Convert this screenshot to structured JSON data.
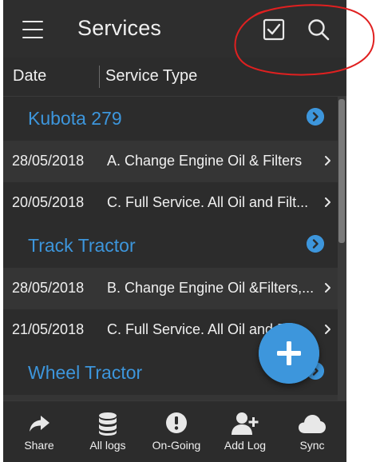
{
  "appbar": {
    "title": "Services",
    "menu_icon": "hamburger-menu-icon",
    "select_icon": "checkbox-icon",
    "search_icon": "search-icon"
  },
  "columns": {
    "date": "Date",
    "service_type": "Service Type"
  },
  "groups": [
    {
      "name": "Kubota 279",
      "rows": [
        {
          "date": "28/05/2018",
          "type": "A. Change Engine Oil & Filters"
        },
        {
          "date": "20/05/2018",
          "type": "C. Full Service. All Oil and Filt..."
        }
      ]
    },
    {
      "name": "Track Tractor",
      "rows": [
        {
          "date": "28/05/2018",
          "type": "B. Change Engine Oil &Filters,..."
        },
        {
          "date": "21/05/2018",
          "type": "C. Full Service. All Oil and Filt..."
        }
      ]
    },
    {
      "name": "Wheel Tractor",
      "rows": []
    }
  ],
  "fab": {
    "icon": "plus-icon"
  },
  "bottom_nav": [
    {
      "label": "Share",
      "icon": "share-icon"
    },
    {
      "label": "All logs",
      "icon": "database-icon"
    },
    {
      "label": "On-Going",
      "icon": "alert-icon"
    },
    {
      "label": "Add Log",
      "icon": "add-user-icon"
    },
    {
      "label": "Sync",
      "icon": "cloud-icon"
    }
  ],
  "colors": {
    "accent": "#3d96dc",
    "background": "#2c2c2c",
    "row_shade": "#353535",
    "text": "#f0f0f0",
    "annotation": "#e02020"
  }
}
